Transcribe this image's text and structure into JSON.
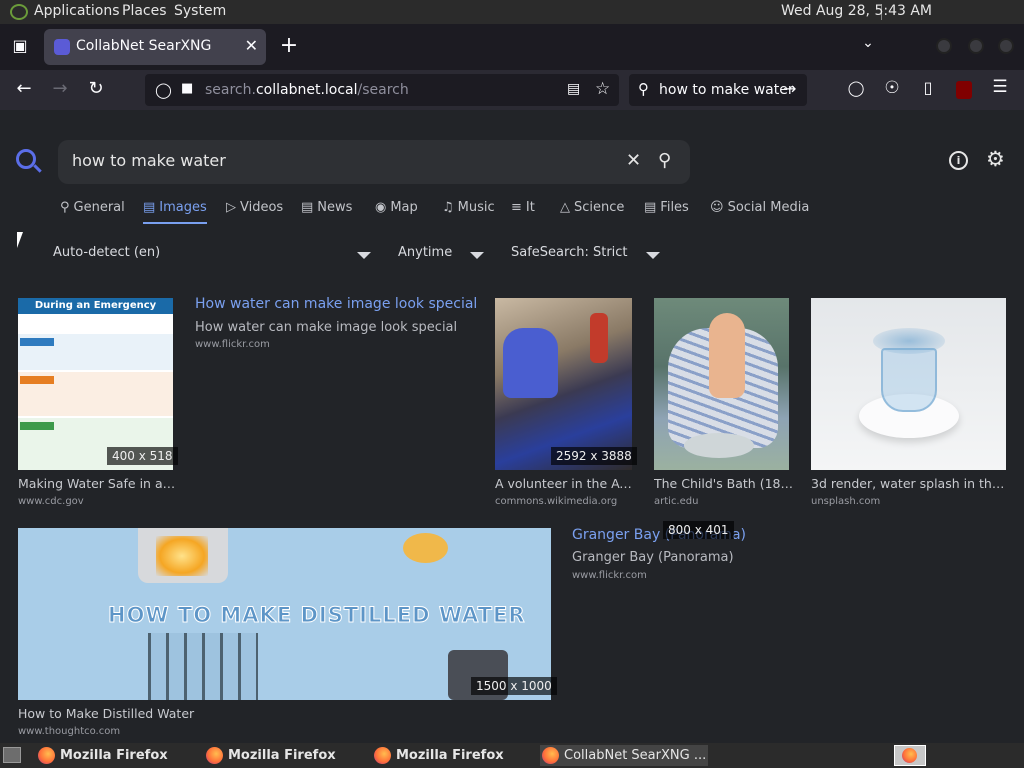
{
  "top_panel": {
    "menus": [
      "Applications",
      "Places",
      "System"
    ],
    "clock": "Wed Aug 28,  5:43 AM"
  },
  "browser": {
    "tab_title": "CollabNet SearXNG",
    "url_host_prefix": "search.",
    "url_host": "collabnet.local",
    "url_path": "/search",
    "search_box": "how to make water"
  },
  "search": {
    "query": "how to make water",
    "categories": [
      {
        "label": "General",
        "icon": "search-icon"
      },
      {
        "label": "Images",
        "icon": "image-icon",
        "active": true
      },
      {
        "label": "Videos",
        "icon": "play-icon"
      },
      {
        "label": "News",
        "icon": "news-icon"
      },
      {
        "label": "Map",
        "icon": "map-pin-icon"
      },
      {
        "label": "Music",
        "icon": "music-icon"
      },
      {
        "label": "It",
        "icon": "layers-icon"
      },
      {
        "label": "Science",
        "icon": "cube-icon"
      },
      {
        "label": "Files",
        "icon": "files-icon"
      },
      {
        "label": "Social Media",
        "icon": "people-icon"
      }
    ],
    "filters": {
      "language": "Auto-detect (en)",
      "time": "Anytime",
      "safesearch": "SafeSearch: Strict"
    }
  },
  "results": [
    {
      "title": "Making Water Safe in an …",
      "url": "www.cdc.gov",
      "dims": "400 x 518",
      "thumb_title": "During an Emergency"
    },
    {
      "link_title": "How water can make image look special",
      "desc": "How water can make image look special",
      "url": "www.flickr.com"
    },
    {
      "title": "A volunteer in the Aw…",
      "url": "commons.wikimedia.org",
      "dims": "2592 x 3888"
    },
    {
      "title": "The Child's Bath (18…",
      "url": "artic.edu"
    },
    {
      "title": "3d render, water splash in the s…",
      "url": "unsplash.com"
    },
    {
      "title": "How to Make Distilled Water",
      "url": "www.thoughtco.com",
      "dims": "1500 x 1000",
      "thumb_text": "HOW TO MAKE DISTILLED WATER"
    },
    {
      "link_title": "Granger Bay (Panorama)",
      "desc": "Granger Bay (Panorama)",
      "url": "www.flickr.com",
      "dims": "800 x 401"
    }
  ],
  "taskbar": {
    "tasks": [
      "Mozilla Firefox",
      "Mozilla Firefox",
      "Mozilla Firefox",
      "CollabNet SearXNG ..."
    ]
  }
}
